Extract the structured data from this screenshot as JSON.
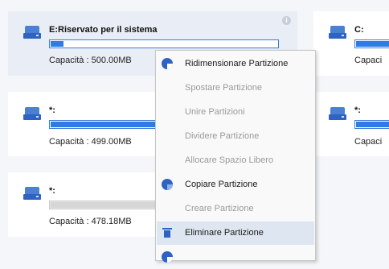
{
  "partitions": [
    {
      "name": "E:Riservato per il sistema",
      "capacity": "Capacità : 500.00MB",
      "fill_percent": 6,
      "selected": true
    },
    {
      "name": "*:",
      "capacity": "Capacità : 499.00MB",
      "fill_percent": 100,
      "selected": false
    },
    {
      "name": "*:",
      "capacity": "Capacità : 478.18MB",
      "fill_percent": 0,
      "selected": false
    }
  ],
  "right_partitions": [
    {
      "name": "C:",
      "capacity": "Capaci"
    },
    {
      "name": "*:",
      "capacity": "Capaci"
    }
  ],
  "info_icon_text": "i",
  "context_menu": {
    "items": [
      {
        "label": "Ridimensionare Partizione",
        "enabled": true,
        "icon": "resize-pie-icon"
      },
      {
        "label": "Spostare Partizione",
        "enabled": false,
        "icon": ""
      },
      {
        "label": "Unire Partizioni",
        "enabled": false,
        "icon": ""
      },
      {
        "label": "Dividere Partizione",
        "enabled": false,
        "icon": ""
      },
      {
        "label": "Allocare Spazio Libero",
        "enabled": false,
        "icon": ""
      },
      {
        "label": "Copiare Partizione",
        "enabled": true,
        "icon": "copy-pie-icon"
      },
      {
        "label": "Creare Partizione",
        "enabled": false,
        "icon": ""
      },
      {
        "label": "Eliminare Partizione",
        "enabled": true,
        "icon": "trash-icon",
        "highlighted": true
      }
    ]
  },
  "colors": {
    "accent": "#2f7ae5",
    "selected_card": "#e9eef6",
    "menu_hover": "#dde6f1"
  }
}
